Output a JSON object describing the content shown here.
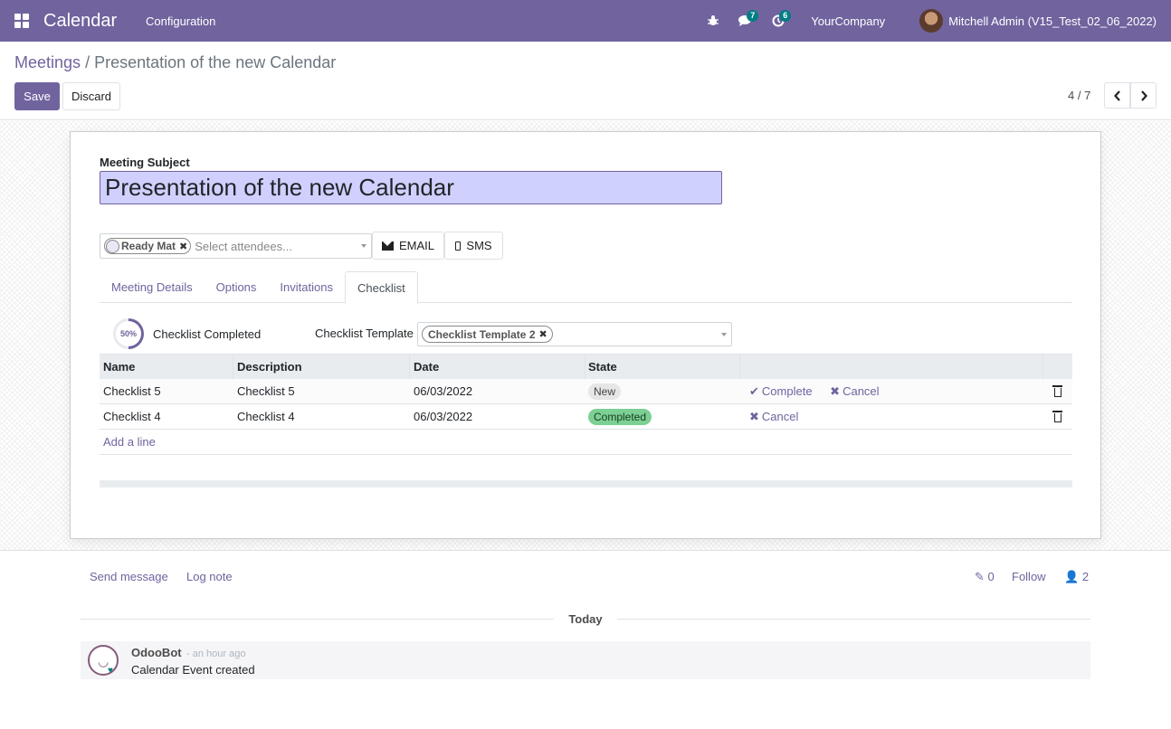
{
  "navbar": {
    "app_title": "Calendar",
    "menu_configuration": "Configuration",
    "messages_count": "7",
    "activities_count": "6",
    "company": "YourCompany",
    "user_name": "Mitchell Admin (V15_Test_02_06_2022)"
  },
  "breadcrumb": {
    "parent": "Meetings",
    "separator": "/",
    "current": "Presentation of the new Calendar"
  },
  "toolbar": {
    "save_label": "Save",
    "discard_label": "Discard",
    "pager": "4 / 7"
  },
  "form": {
    "subject_label": "Meeting Subject",
    "subject_value": "Presentation of the new Calendar",
    "attendee_tag": "Ready Mat",
    "attendee_placeholder": "Select attendees...",
    "email_label": "EMAIL",
    "sms_label": "SMS",
    "tabs": [
      {
        "label": "Meeting Details"
      },
      {
        "label": "Options"
      },
      {
        "label": "Invitations"
      },
      {
        "label": "Checklist"
      }
    ],
    "active_tab": "Checklist",
    "checklist_progress": "50%",
    "checklist_completed_label": "Checklist Completed",
    "template_label": "Checklist Template",
    "template_value": "Checklist Template 2"
  },
  "checklist_table": {
    "columns": [
      "Name",
      "Description",
      "Date",
      "State"
    ],
    "rows": [
      {
        "name": "Checklist 5",
        "description": "Checklist 5",
        "date": "06/03/2022",
        "state": "New",
        "action_complete": "Complete",
        "action_cancel": "Cancel"
      },
      {
        "name": "Checklist 4",
        "description": "Checklist 4",
        "date": "06/03/2022",
        "state": "Completed",
        "action_cancel": "Cancel"
      }
    ],
    "add_line": "Add a line"
  },
  "chatter": {
    "send_message": "Send message",
    "log_note": "Log note",
    "attachments_count": "0",
    "follow": "Follow",
    "followers_count": "2",
    "today": "Today",
    "author": "OdooBot",
    "time_ago": "- an hour ago",
    "body": "Calendar Event created"
  },
  "colors": {
    "brand": "#71639e",
    "completed_badge": "#7cd093",
    "subject_highlight": "#d0d0ff"
  }
}
